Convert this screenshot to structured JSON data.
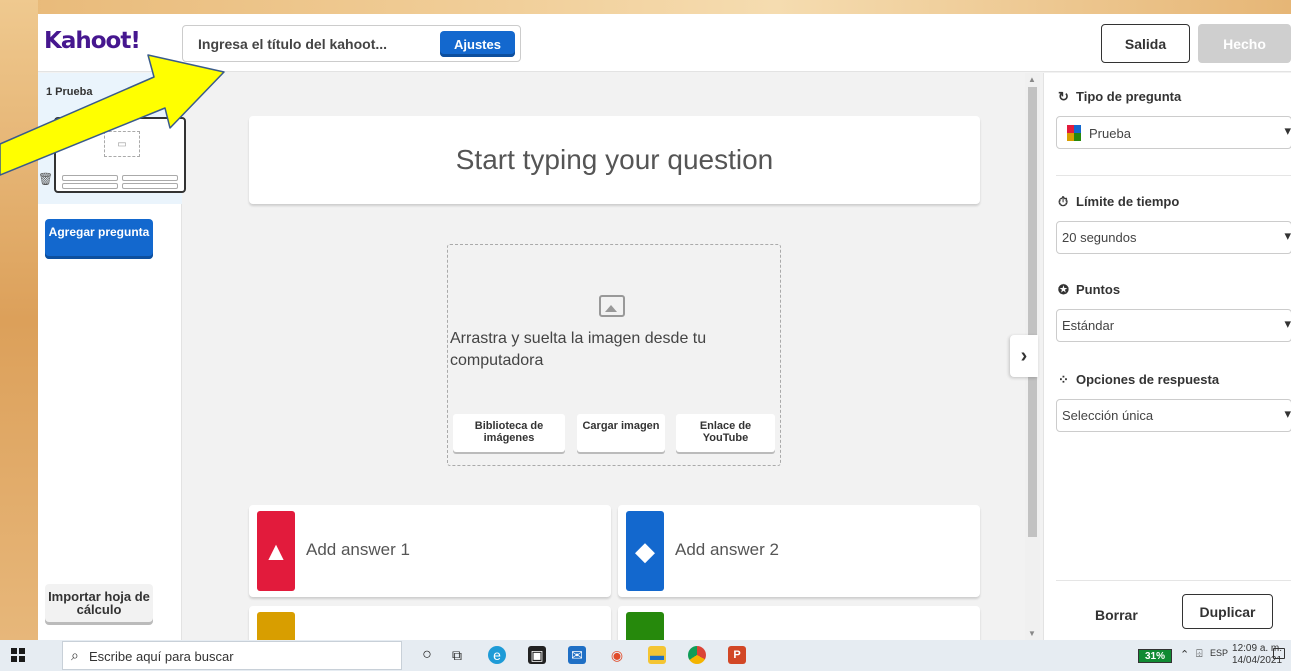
{
  "app": {
    "logo": "Kahoot!",
    "title_placeholder": "Ingresa el título del kahoot...",
    "settings_label": "Ajustes",
    "exit_label": "Salida",
    "done_label": "Hecho"
  },
  "sidebar": {
    "slide_label": "1  Prueba",
    "add_question_label": "Agregar pregunta",
    "import_label": "Importar hoja de cálculo"
  },
  "editor": {
    "question_placeholder": "Start typing your question",
    "media_text": "Arrastra y suelta la imagen desde tu computadora",
    "media_buttons": [
      "Biblioteca de imágenes",
      "Cargar imagen",
      "Enlace de YouTube"
    ],
    "answers": [
      {
        "label": "Add answer 1",
        "color": "#e21b3c",
        "shape": "triangle-icon"
      },
      {
        "label": "Add answer 2",
        "color": "#1368ce",
        "shape": "diamond-icon"
      },
      {
        "label": "",
        "color": "#d89e00",
        "shape": "circle-icon"
      },
      {
        "label": "",
        "color": "#26890c",
        "shape": "square-icon"
      }
    ]
  },
  "panel": {
    "question_type_title": "Tipo de pregunta",
    "question_type_value": "Prueba",
    "time_limit_title": "Límite de tiempo",
    "time_limit_value": "20 segundos",
    "points_title": "Puntos",
    "points_value": "Estándar",
    "answer_options_title": "Opciones de respuesta",
    "answer_options_value": "Selección única",
    "delete_label": "Borrar",
    "duplicate_label": "Duplicar"
  },
  "taskbar": {
    "search_placeholder": "Escribe aquí para buscar",
    "battery": "31%",
    "language": "ESP",
    "time": "12:09 a. m.",
    "date": "14/04/2021"
  },
  "colors": {
    "brand_purple": "#46178f",
    "primary_blue": "#1368ce",
    "arrow_yellow": "#ffff00"
  }
}
